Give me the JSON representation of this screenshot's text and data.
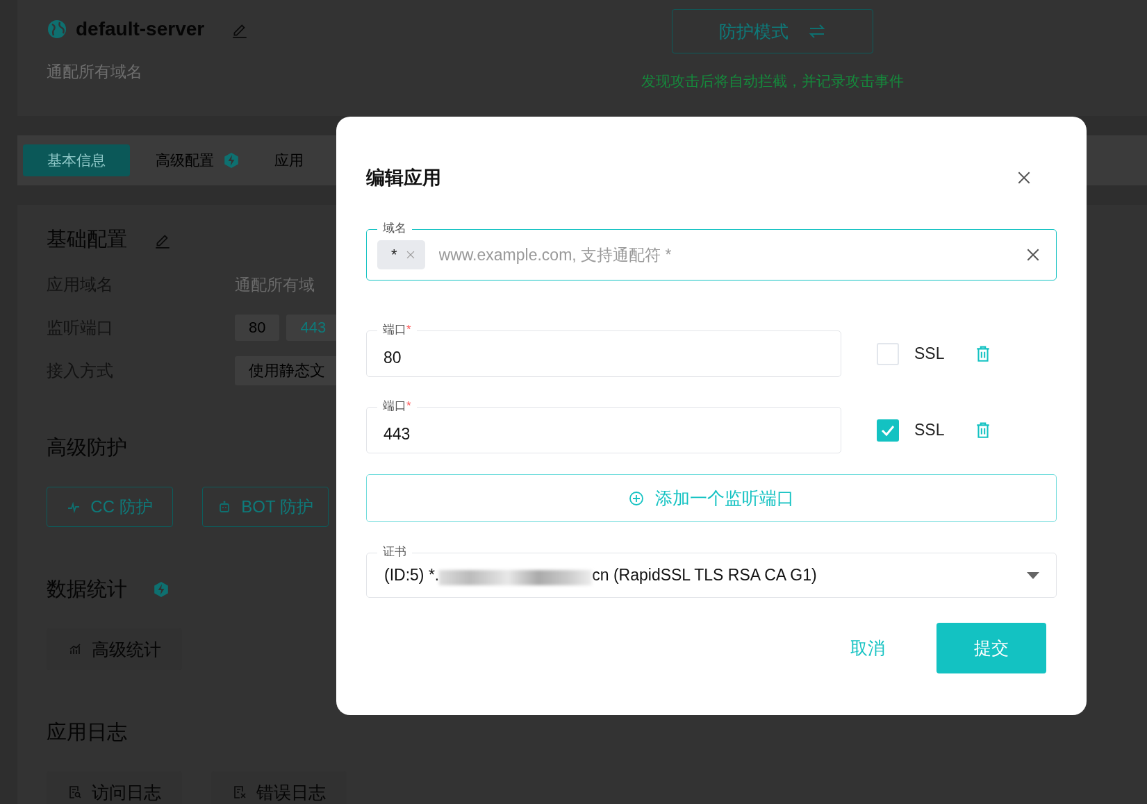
{
  "header": {
    "server_name": "default-server",
    "subtitle": "通配所有域名",
    "mode_button": "防护模式",
    "mode_hint": "发现攻击后将自动拦截，并记录攻击事件"
  },
  "tabs": [
    {
      "label": "基本信息",
      "selected": true,
      "badge": false
    },
    {
      "label": "高级配置",
      "selected": false,
      "badge": true
    },
    {
      "label": "应用",
      "selected": false,
      "badge": false
    }
  ],
  "basic": {
    "title": "基础配置",
    "rows": [
      {
        "label": "应用域名",
        "kind": "plain",
        "values": [
          {
            "text": "通配所有域",
            "highlighted": false
          }
        ]
      },
      {
        "label": "监听端口",
        "kind": "chips",
        "values": [
          {
            "text": "80",
            "highlighted": false
          },
          {
            "text": "443",
            "highlighted": true
          }
        ]
      },
      {
        "label": "接入方式",
        "kind": "chips",
        "values": [
          {
            "text": "使用静态文",
            "highlighted": false
          }
        ]
      }
    ]
  },
  "protection": {
    "title": "高级防护",
    "buttons": [
      {
        "label": "CC 防护",
        "kind": "pulse"
      },
      {
        "label": "BOT 防护",
        "kind": "robot"
      }
    ]
  },
  "stats": {
    "title": "数据统计",
    "badge": true,
    "buttons": [
      {
        "label": "高级统计",
        "kind": "chart"
      }
    ]
  },
  "logs": {
    "title": "应用日志",
    "buttons": [
      {
        "label": "访问日志",
        "kind": "access"
      },
      {
        "label": "错误日志",
        "kind": "error"
      }
    ]
  },
  "dialog": {
    "title": "编辑应用",
    "domain": {
      "label": "域名",
      "tags": [
        "*"
      ],
      "placeholder": "www.example.com, 支持通配符 *"
    },
    "ports": [
      {
        "label": "端口",
        "required_mark": "*",
        "value": "80",
        "ssl_label": "SSL",
        "ssl": false
      },
      {
        "label": "端口",
        "required_mark": "*",
        "value": "443",
        "ssl_label": "SSL",
        "ssl": true
      }
    ],
    "add_port": "添加一个监听端口",
    "certificate": {
      "label": "证书",
      "value_parts": [
        "(ID:5) *.",
        "cn (RapidSSL TLS RSA CA G1)"
      ]
    },
    "cancel": "取消",
    "submit": "提交"
  }
}
